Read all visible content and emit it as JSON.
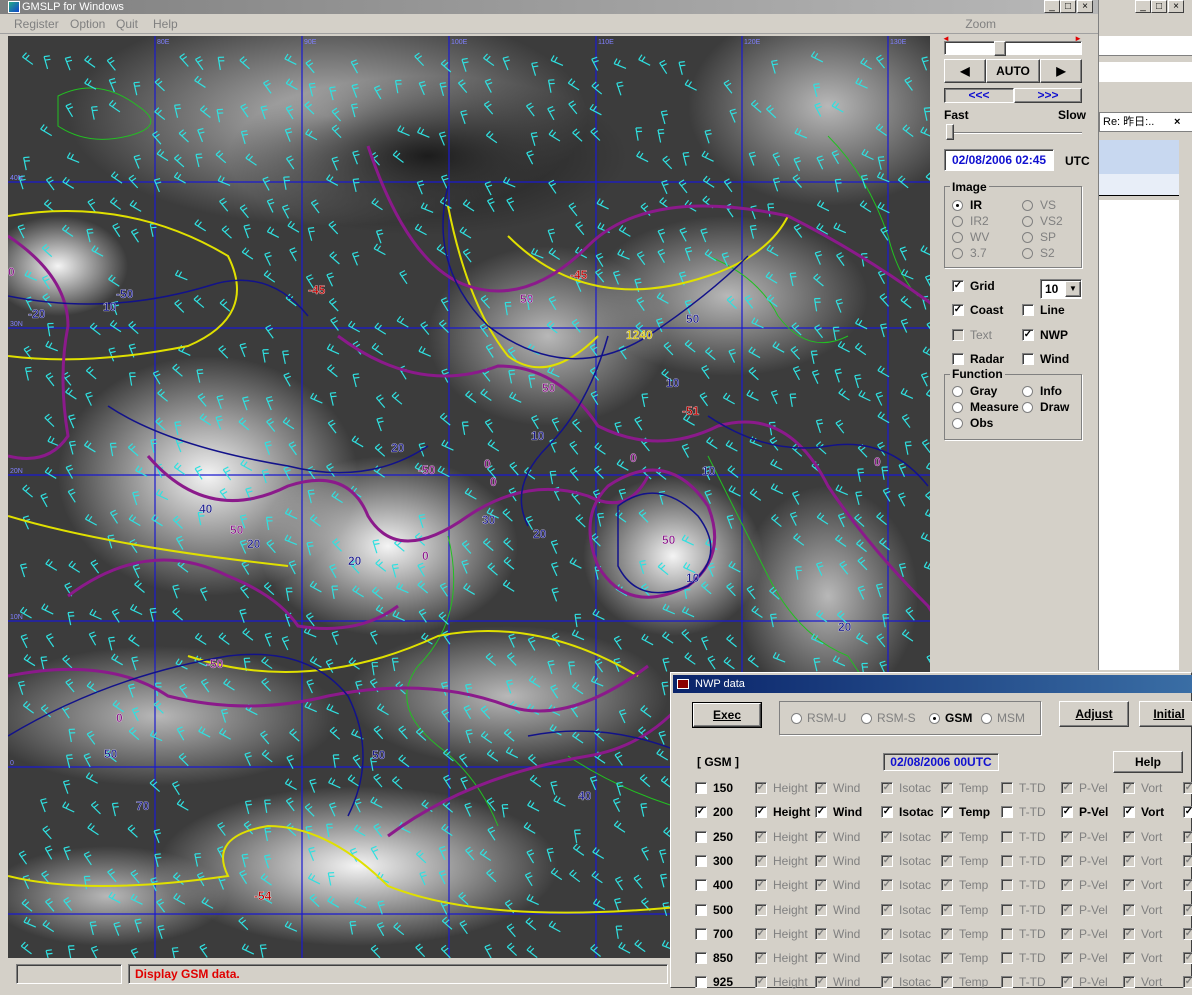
{
  "window": {
    "title": "GMSLP for Windows",
    "min": "_",
    "max": "□",
    "close": "×"
  },
  "menu": {
    "register": "Register",
    "option": "Option",
    "quit": "Quit",
    "help": "Help",
    "zoom": "Zoom"
  },
  "map": {
    "grid_labels_top": [
      "80E",
      "90E",
      "100E",
      "110E",
      "120E",
      "130E"
    ],
    "grid_labels_left": [
      "40N",
      "30N",
      "20N",
      "10N",
      "0"
    ],
    "contour_labels": [
      {
        "text": "10",
        "color": "#1a1a8c"
      },
      {
        "text": "-50",
        "color": "#1a1a8c"
      },
      {
        "text": "-20",
        "color": "#1a1a8c"
      },
      {
        "text": "0",
        "color": "#8b1a8b"
      },
      {
        "text": "-45",
        "color": "#c00000"
      },
      {
        "text": "-45",
        "color": "#c00000"
      },
      {
        "text": "50",
        "color": "#8b1a8b"
      },
      {
        "text": "50",
        "color": "#1a1a8c"
      },
      {
        "text": "1240",
        "color": "#d4c000"
      },
      {
        "text": "50",
        "color": "#8b1a8b"
      },
      {
        "text": "10",
        "color": "#1a1a8c"
      },
      {
        "text": "-51",
        "color": "#c00000"
      },
      {
        "text": "10",
        "color": "#1a1a8c"
      },
      {
        "text": "0",
        "color": "#8b1a8b"
      },
      {
        "text": "20",
        "color": "#1a1a8c"
      },
      {
        "text": "-50",
        "color": "#8b1a8b"
      },
      {
        "text": "0",
        "color": "#8b1a8b"
      },
      {
        "text": "0",
        "color": "#8b1a8b"
      },
      {
        "text": "10",
        "color": "#1a1a8c"
      },
      {
        "text": "0",
        "color": "#8b1a8b"
      },
      {
        "text": "40",
        "color": "#1a1a8c"
      },
      {
        "text": "50",
        "color": "#8b1a8b"
      },
      {
        "text": "20",
        "color": "#1a1a8c"
      },
      {
        "text": "30",
        "color": "#1a1a8c"
      },
      {
        "text": "20",
        "color": "#1a1a8c"
      },
      {
        "text": "50",
        "color": "#8b1a8b"
      },
      {
        "text": "10",
        "color": "#1a1a8c"
      },
      {
        "text": "20",
        "color": "#1a1a8c"
      },
      {
        "text": "0",
        "color": "#8b1a8b"
      },
      {
        "text": "-50",
        "color": "#8b1a8b"
      },
      {
        "text": "20",
        "color": "#1a1a8c"
      },
      {
        "text": "0",
        "color": "#8b1a8b"
      },
      {
        "text": "50",
        "color": "#1a1a8c"
      },
      {
        "text": "50",
        "color": "#1a1a8c"
      },
      {
        "text": "70",
        "color": "#1a1a8c"
      },
      {
        "text": "40",
        "color": "#1a1a8c"
      },
      {
        "text": "-54",
        "color": "#c00000"
      }
    ]
  },
  "controls": {
    "prev": "◀",
    "auto": "AUTO",
    "next": "▶",
    "rewind": "<<<",
    "forward": ">>>",
    "fast": "Fast",
    "slow": "Slow",
    "datetime": "02/08/2006 02:45",
    "utc": "UTC",
    "image_group": "Image",
    "image_options": [
      {
        "label": "IR",
        "selected": true,
        "enabled": true
      },
      {
        "label": "VS",
        "selected": false,
        "enabled": false
      },
      {
        "label": "IR2",
        "selected": false,
        "enabled": false
      },
      {
        "label": "VS2",
        "selected": false,
        "enabled": false
      },
      {
        "label": "WV",
        "selected": false,
        "enabled": false
      },
      {
        "label": "SP",
        "selected": false,
        "enabled": false
      },
      {
        "label": "3.7",
        "selected": false,
        "enabled": false
      },
      {
        "label": "S2",
        "selected": false,
        "enabled": false
      }
    ],
    "grid": "Grid",
    "grid_value": "10",
    "coast": "Coast",
    "line": "Line",
    "text": "Text",
    "nwp": "NWP",
    "radar": "Radar",
    "wind": "Wind",
    "function_group": "Function",
    "function_options": [
      {
        "label": "Gray",
        "selected": false
      },
      {
        "label": "Info",
        "selected": false
      },
      {
        "label": "Measure",
        "selected": false
      },
      {
        "label": "Draw",
        "selected": false
      },
      {
        "label": "Obs",
        "selected": false
      }
    ]
  },
  "side_window": {
    "tab": "Re: 昨日:..",
    "close": "×",
    "min": "_",
    "max": "□",
    "xclose": "×"
  },
  "status": {
    "message": "Display GSM data."
  },
  "nwp_dialog": {
    "title": "NWP data",
    "exec": "Exec",
    "models": [
      {
        "label": "RSM-U",
        "selected": false
      },
      {
        "label": "RSM-S",
        "selected": false
      },
      {
        "label": "GSM",
        "selected": true
      },
      {
        "label": "MSM",
        "selected": false
      }
    ],
    "adjust": "Adjust",
    "initial": "Initial",
    "model_label": "[ GSM ]",
    "datetime": "02/08/2006 00UTC",
    "help": "Help",
    "columns": [
      "Height",
      "Wind",
      "Isotac",
      "Temp",
      "T-TD",
      "P-Vel",
      "Vort"
    ],
    "levels": [
      {
        "level": "150",
        "on": false
      },
      {
        "level": "200",
        "on": true
      },
      {
        "level": "250",
        "on": false
      },
      {
        "level": "300",
        "on": false
      },
      {
        "level": "400",
        "on": false
      },
      {
        "level": "500",
        "on": false
      },
      {
        "level": "700",
        "on": false
      },
      {
        "level": "850",
        "on": false
      },
      {
        "level": "925",
        "on": false
      }
    ]
  }
}
